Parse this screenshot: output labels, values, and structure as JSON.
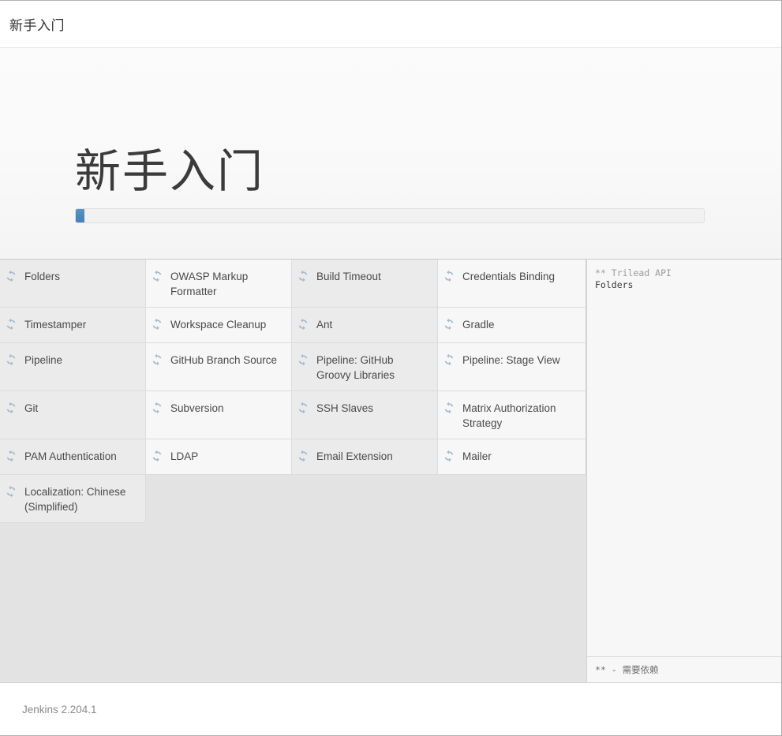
{
  "window": {
    "title": "新手入门"
  },
  "setup": {
    "heading": "新手入门",
    "progress": {
      "percent": 1.4,
      "fill_color": "#4b87bd",
      "track_color": "#f1f1f1"
    }
  },
  "plugins": {
    "icon_name": "refresh-spinner-icon",
    "icon_color": "#a7bccd",
    "items": [
      {
        "name": "Folders"
      },
      {
        "name": "OWASP Markup Formatter"
      },
      {
        "name": "Build Timeout"
      },
      {
        "name": "Credentials Binding"
      },
      {
        "name": "Timestamper"
      },
      {
        "name": "Workspace Cleanup"
      },
      {
        "name": "Ant"
      },
      {
        "name": "Gradle"
      },
      {
        "name": "Pipeline"
      },
      {
        "name": "GitHub Branch Source"
      },
      {
        "name": "Pipeline: GitHub Groovy Libraries"
      },
      {
        "name": "Pipeline: Stage View"
      },
      {
        "name": "Git"
      },
      {
        "name": "Subversion"
      },
      {
        "name": "SSH Slaves"
      },
      {
        "name": "Matrix Authorization Strategy"
      },
      {
        "name": "PAM Authentication"
      },
      {
        "name": "LDAP"
      },
      {
        "name": "Email Extension"
      },
      {
        "name": "Mailer"
      },
      {
        "name": "Localization: Chinese (Simplified)"
      }
    ]
  },
  "install_log": {
    "lines": [
      {
        "text": "** Trilead API",
        "emphasis": "dim"
      },
      {
        "text": "Folders",
        "emphasis": "strong"
      }
    ],
    "footnote": "** - 需要依赖"
  },
  "footer": {
    "version": "Jenkins 2.204.1"
  }
}
